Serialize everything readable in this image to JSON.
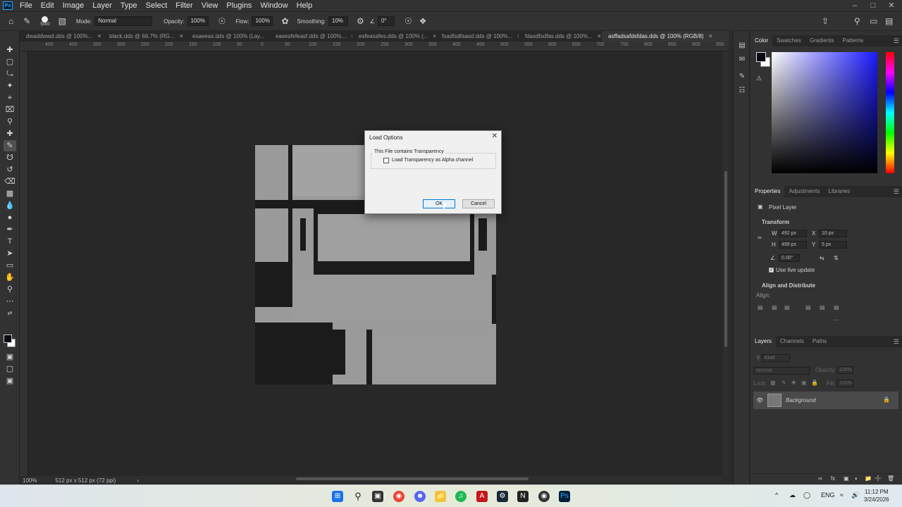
{
  "app": {
    "logo": "Ps"
  },
  "menu": [
    "File",
    "Edit",
    "Image",
    "Layer",
    "Type",
    "Select",
    "Filter",
    "View",
    "Plugins",
    "Window",
    "Help"
  ],
  "options": {
    "brush_size": "5000",
    "mode_label": "Mode:",
    "mode_value": "Normal",
    "opacity_label": "Opacity:",
    "opacity_value": "100%",
    "flow_label": "Flow:",
    "flow_value": "100%",
    "smoothing_label": "Smoothing:",
    "smoothing_value": "10%",
    "angle_value": "0°"
  },
  "tabs": [
    {
      "label": "dwaddwwd.dds @ 100%..."
    },
    {
      "label": "black.dds @ 66.7% (RG..."
    },
    {
      "label": "esaeeas.dds @ 100% (Lay..."
    },
    {
      "label": "easesfefeasf.dds @ 100%..."
    },
    {
      "label": "esfeasafes.dds @ 100% (..."
    },
    {
      "label": "fsadfsdfaasd.dds @ 100%..."
    },
    {
      "label": "fdasdfsdfas.dds @ 100%..."
    },
    {
      "label": "asffadsafdsfdas.dds @ 100% (RGB/8)",
      "active": true
    }
  ],
  "ruler": [
    "450",
    "400",
    "350",
    "300",
    "250",
    "200",
    "150",
    "100",
    "50",
    "0",
    "50",
    "100",
    "150",
    "200",
    "250",
    "300",
    "350",
    "400",
    "450",
    "500",
    "550",
    "600",
    "650",
    "700",
    "750",
    "800",
    "850",
    "900",
    "950"
  ],
  "status": {
    "zoom": "100%",
    "doc_info": "512 px x 512 px (72 ppi)"
  },
  "color_panel": {
    "tabs": [
      "Color",
      "Swatches",
      "Gradients",
      "Patterns"
    ]
  },
  "properties_panel": {
    "tabs": [
      "Properties",
      "Adjustments",
      "Libraries"
    ],
    "layer_type": "Pixel Layer",
    "transform_title": "Transform",
    "w_label": "W",
    "w_value": "492 px",
    "x_label": "X",
    "x_value": "10 px",
    "h_label": "H",
    "h_value": "499 px",
    "y_label": "Y",
    "y_value": "5 px",
    "angle_value": "0.00°",
    "live_update": "Use live update",
    "align_title": "Align and Distribute",
    "align_label": "Align:"
  },
  "layers_panel": {
    "tabs": [
      "Layers",
      "Channels",
      "Paths"
    ],
    "kind_placeholder": "Kind",
    "blend_mode": "Normal",
    "opacity_label": "Opacity:",
    "opacity_value": "100%",
    "lock_label": "Lock:",
    "fill_label": "Fill:",
    "fill_value": "100%",
    "layer_name": "Background"
  },
  "dialog": {
    "title": "Load Options",
    "group_label": "This File contains Transparency",
    "checkbox_label": "Load Transparency as Alpha channel",
    "checked": false,
    "ok_label": "OK",
    "cancel_label": "Cancel"
  },
  "taskbar": {
    "tray_lang": "ENG",
    "time": "11:12 PM",
    "date": "3/24/2026"
  }
}
